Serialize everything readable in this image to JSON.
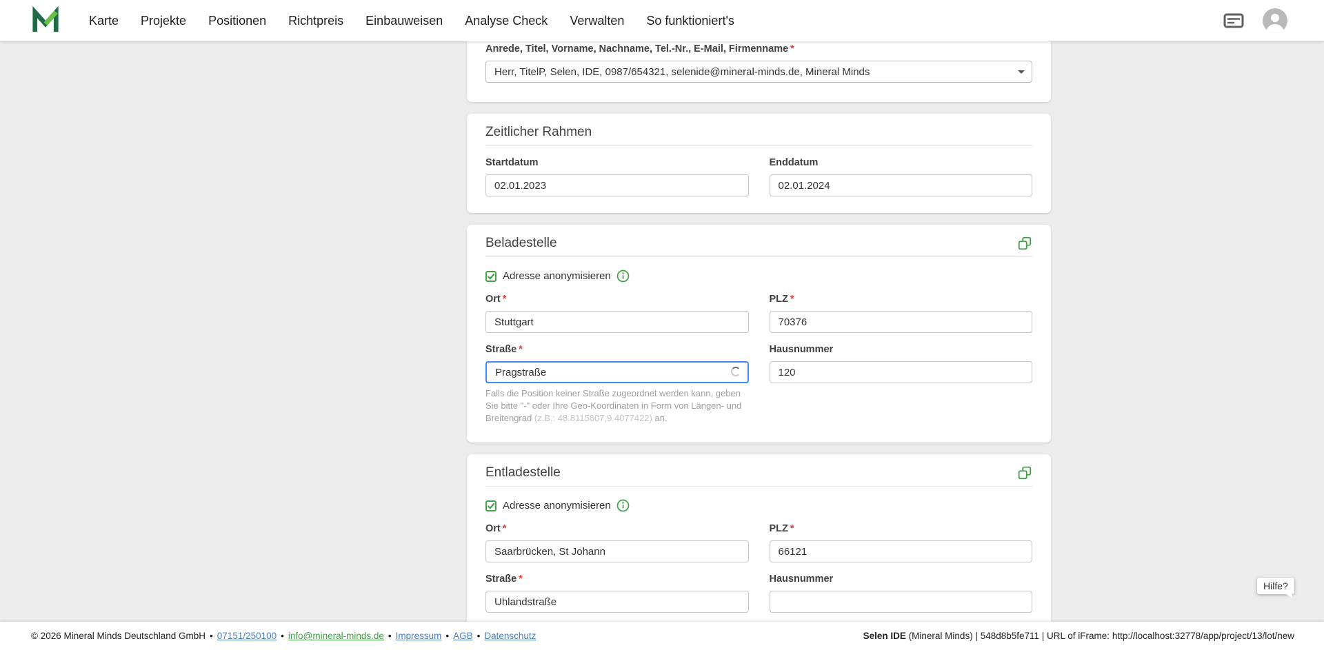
{
  "navbar": {
    "items": [
      "Karte",
      "Projekte",
      "Positionen",
      "Richtpreis",
      "Einbauweisen",
      "Analyse Check",
      "Verwalten",
      "So funktioniert's"
    ]
  },
  "misc": {
    "required": "*",
    "separator": "•"
  },
  "contact_card": {
    "label": "Anrede, Titel, Vorname, Nachname, Tel.-Nr., E-Mail, Firmenname",
    "value": "Herr, TitelP, Selen, IDE, 0987/654321, selenide@mineral-minds.de, Mineral Minds"
  },
  "timeframe_card": {
    "title": "Zeitlicher Rahmen",
    "start": {
      "label": "Startdatum",
      "value": "02.01.2023"
    },
    "end": {
      "label": "Enddatum",
      "value": "02.01.2024"
    }
  },
  "loading_card": {
    "title": "Beladestelle",
    "anonymize_label": "Adresse anonymisieren",
    "ort": {
      "label": "Ort",
      "value": "Stuttgart"
    },
    "plz": {
      "label": "PLZ",
      "value": "70376"
    },
    "strasse": {
      "label": "Straße",
      "value": "Pragstraße"
    },
    "hausnummer": {
      "label": "Hausnummer",
      "value": "120"
    },
    "helper": {
      "text": "Falls die Position keiner Straße zugeordnet werden kann, geben Sie bitte \"-\" oder Ihre Geo-Koordinaten in Form von Längen- und Breitengrad ",
      "example": "(z.B.: 48.8115607,9.4077422)",
      "suffix": " an."
    }
  },
  "unloading_card": {
    "title": "Entladestelle",
    "anonymize_label": "Adresse anonymisieren",
    "ort": {
      "label": "Ort",
      "value": "Saarbrücken, St Johann"
    },
    "plz": {
      "label": "PLZ",
      "value": "66121"
    },
    "strasse": {
      "label": "Straße",
      "value": "Uhlandstraße"
    },
    "hausnummer": {
      "label": "Hausnummer",
      "value": ""
    }
  },
  "help_button": {
    "label": "Hilfe?"
  },
  "footer": {
    "copyright": "© 2026 Mineral Minds Deutschland GmbH",
    "phone": "07151/250100",
    "email": "info@mineral-minds.de",
    "impressum": "Impressum",
    "agb": "AGB",
    "datenschutz": "Datenschutz",
    "right_bold": "Selen IDE",
    "right_rest": " (Mineral Minds) | 548d8b5fe711 | URL of iFrame: http://localhost:32778/app/project/13/lot/new"
  },
  "colors": {
    "brand_green": "#43a047",
    "focus_blue": "#4285f4",
    "required_red": "#e53935",
    "link_blue": "#4a7ebb",
    "link_green": "#43a047",
    "background": "#ececec"
  }
}
